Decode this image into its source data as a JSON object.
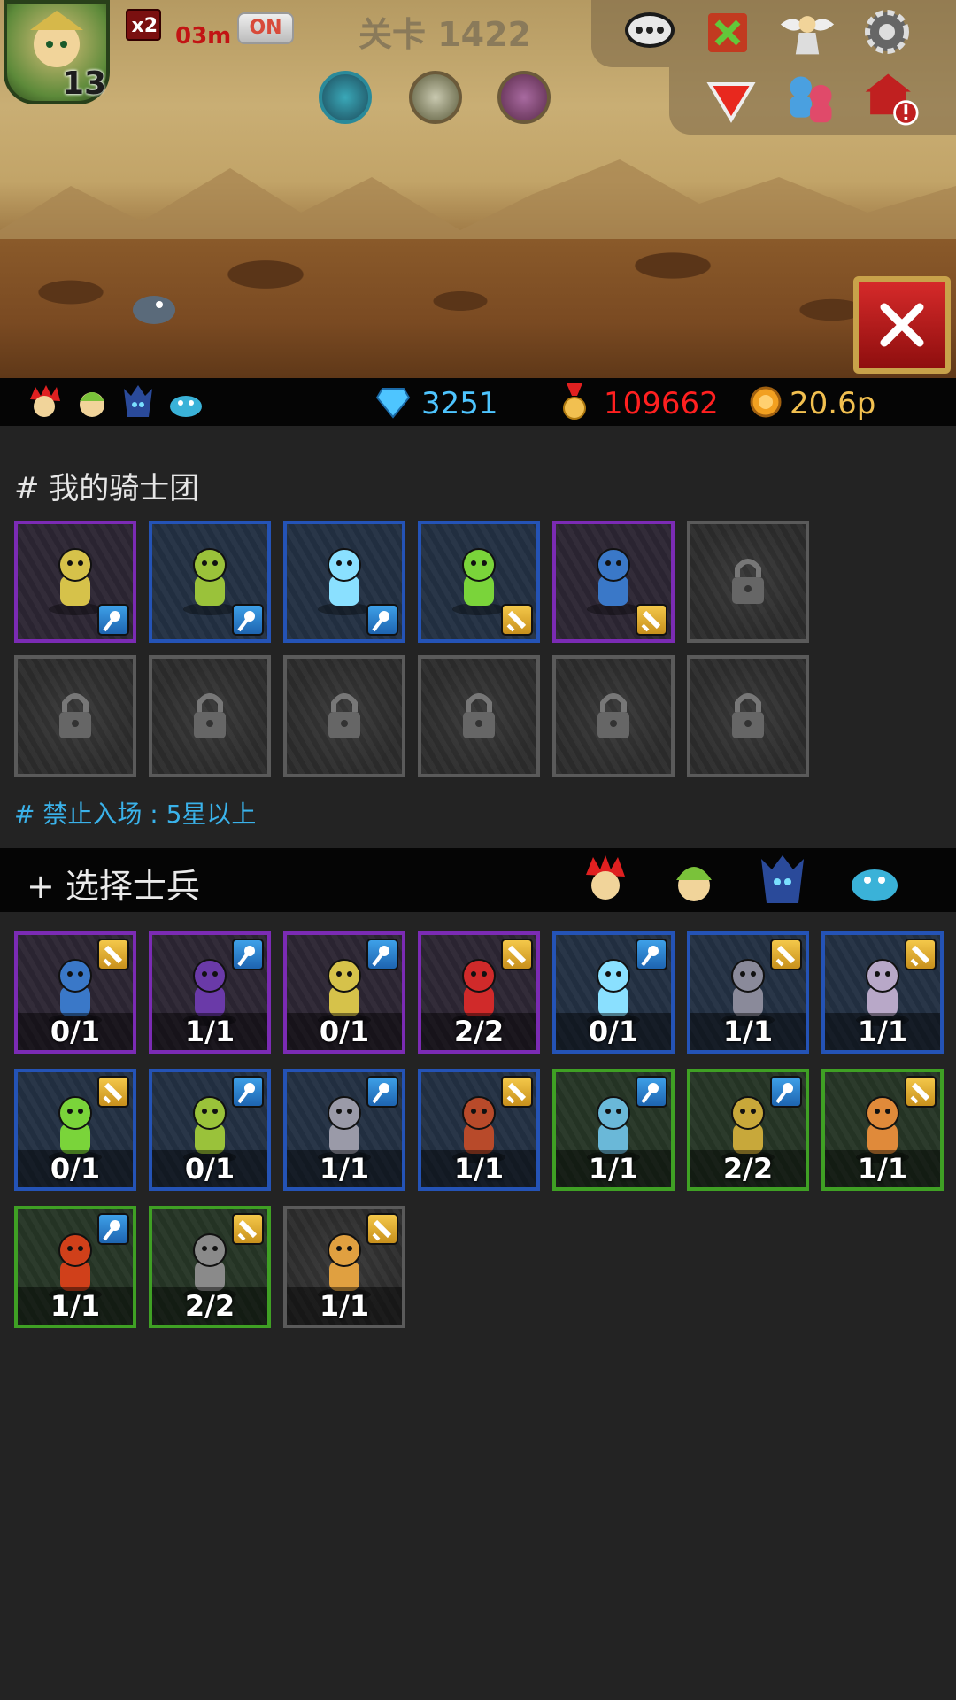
{
  "hud": {
    "hero_level": "13",
    "speed_multiplier": "x2",
    "speed_time": "03m",
    "auto_toggle": "ON",
    "stage_title": "关卡 1422"
  },
  "resources": {
    "diamonds": "3251",
    "medals": "109662",
    "gold": "20.6p"
  },
  "colors": {
    "diamond": "#4ec5ff",
    "medal": "#ff2020",
    "gold": "#f2c050",
    "note": "#3ab2ea",
    "rarity_purple": "#7b2bb4",
    "rarity_blue": "#2453b6",
    "rarity_green": "#3fa024",
    "close_red": "#d62a2a"
  },
  "knights": {
    "title": "# 我的骑士团",
    "slots": [
      {
        "rarity": "purple",
        "unit": "elf-archer",
        "type": "magic"
      },
      {
        "rarity": "blue",
        "unit": "goblin-archer",
        "type": "magic"
      },
      {
        "rarity": "blue",
        "unit": "ice-dragon",
        "type": "magic"
      },
      {
        "rarity": "blue",
        "unit": "green-bird",
        "type": "melee"
      },
      {
        "rarity": "purple",
        "unit": "blue-ogre",
        "type": "melee"
      },
      {
        "rarity": "locked"
      }
    ],
    "locked_row": 6
  },
  "restriction_note": "# 禁止入场 : 5星以上",
  "select": {
    "title": "+ 选择士兵",
    "factions": [
      "red-faction-icon",
      "green-faction-icon",
      "dark-faction-icon",
      "blue-faction-icon"
    ]
  },
  "soldiers": [
    {
      "rarity": "purple",
      "unit": "blue-ogre",
      "type": "melee",
      "count": "0/1"
    },
    {
      "rarity": "purple",
      "unit": "hooded-mage",
      "type": "magic",
      "count": "1/1"
    },
    {
      "rarity": "purple",
      "unit": "elf-archer",
      "type": "magic",
      "count": "0/1"
    },
    {
      "rarity": "purple",
      "unit": "red-knight",
      "type": "melee",
      "count": "2/2"
    },
    {
      "rarity": "blue",
      "unit": "ice-dragon",
      "type": "magic",
      "count": "0/1"
    },
    {
      "rarity": "blue",
      "unit": "flail-knight",
      "type": "melee",
      "count": "1/1"
    },
    {
      "rarity": "blue",
      "unit": "skeleton-rogue",
      "type": "melee",
      "count": "1/1"
    },
    {
      "rarity": "blue",
      "unit": "green-bird",
      "type": "melee",
      "count": "0/1"
    },
    {
      "rarity": "blue",
      "unit": "goblin-archer",
      "type": "magic",
      "count": "0/1"
    },
    {
      "rarity": "blue",
      "unit": "armored-warrior",
      "type": "magic",
      "count": "1/1"
    },
    {
      "rarity": "blue",
      "unit": "bandit",
      "type": "melee",
      "count": "1/1"
    },
    {
      "rarity": "green",
      "unit": "skull-shaman",
      "type": "magic",
      "count": "1/1"
    },
    {
      "rarity": "green",
      "unit": "goblin-scout",
      "type": "magic",
      "count": "2/2"
    },
    {
      "rarity": "green",
      "unit": "orange-brawler",
      "type": "melee",
      "count": "1/1"
    },
    {
      "rarity": "green",
      "unit": "red-phoenix",
      "type": "magic",
      "count": "1/1"
    },
    {
      "rarity": "green",
      "unit": "grey-golem",
      "type": "melee",
      "count": "2/2"
    },
    {
      "rarity": "gray",
      "unit": "monkey-fighter",
      "type": "melee",
      "count": "1/1"
    }
  ]
}
